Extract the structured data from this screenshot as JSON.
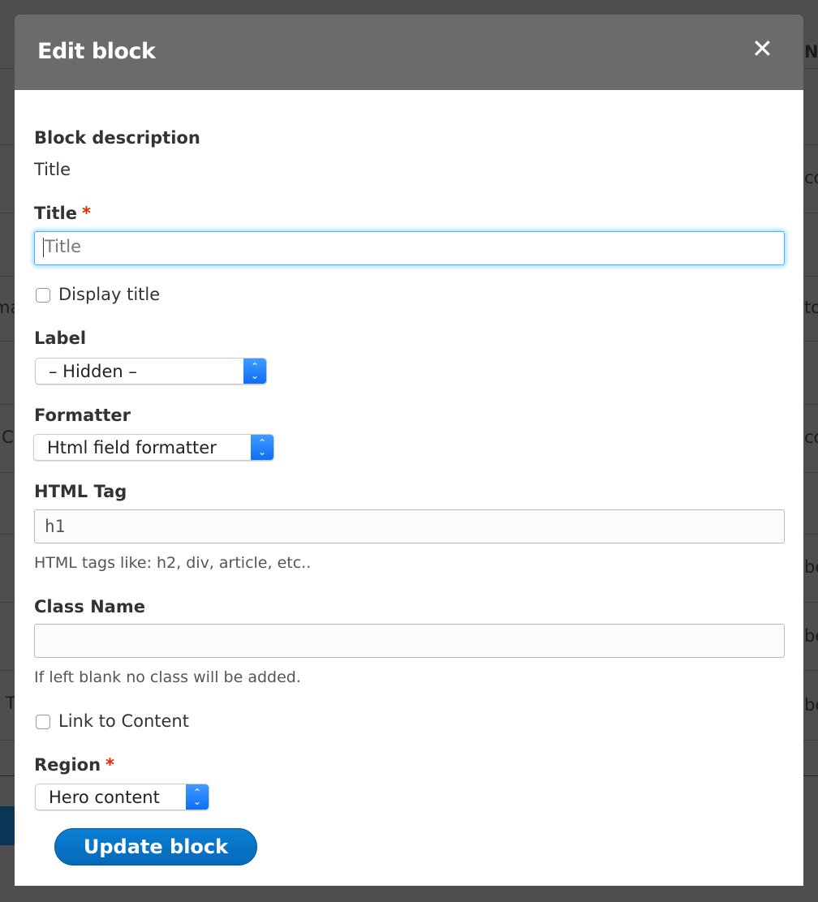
{
  "background": {
    "left_fragments": [
      "ma",
      "C",
      "t T"
    ],
    "right_fragments": [
      "N",
      "co",
      "to",
      "co",
      "be",
      "be",
      "be"
    ]
  },
  "dialog": {
    "title": "Edit block",
    "close_icon": "close-icon",
    "block_description": {
      "label": "Block description",
      "value": "Title"
    },
    "title_field": {
      "label": "Title",
      "required_marker": "*",
      "value": "",
      "placeholder": "Title"
    },
    "display_title": {
      "label": "Display title",
      "checked": false
    },
    "label_select": {
      "label": "Label",
      "selected": "– Hidden –"
    },
    "formatter_select": {
      "label": "Formatter",
      "selected": "Html field formatter"
    },
    "html_tag": {
      "label": "HTML Tag",
      "value": "h1",
      "help": "HTML tags like: h2, div, article, etc.."
    },
    "class_name": {
      "label": "Class Name",
      "value": "",
      "help": "If left blank no class will be added."
    },
    "link_to_content": {
      "label": "Link to Content",
      "checked": false
    },
    "region_select": {
      "label": "Region",
      "required_marker": "*",
      "selected": "Hero content"
    },
    "submit_label": "Update block"
  },
  "colors": {
    "header": "#6b6b6b",
    "primary_button": "#0771c6",
    "required": "#e62600",
    "focus": "#40b6ff"
  }
}
